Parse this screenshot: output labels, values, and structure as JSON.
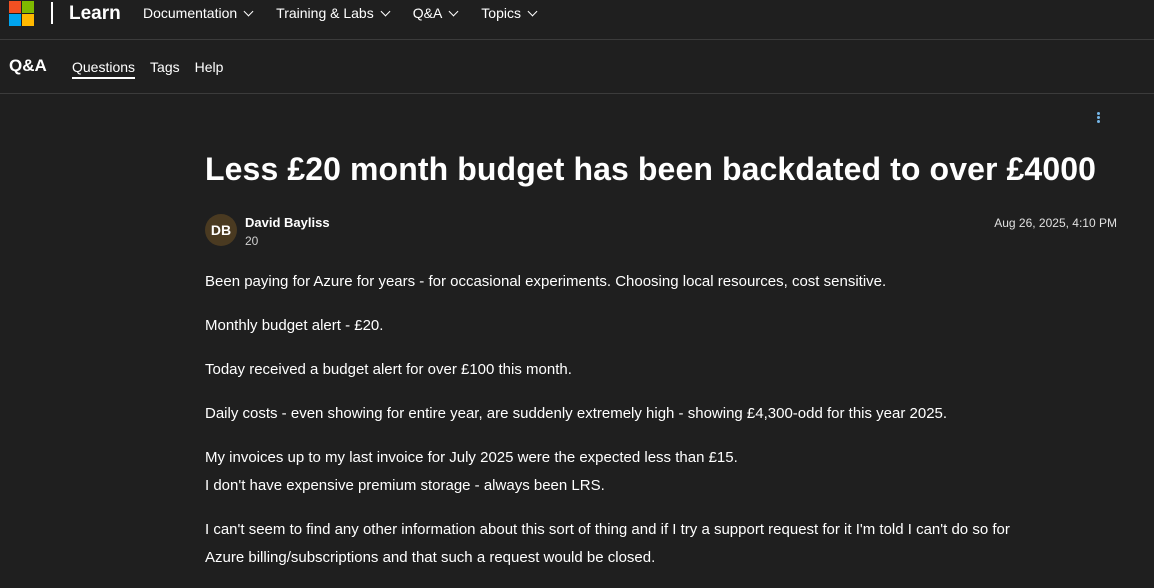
{
  "header": {
    "brand": "Learn",
    "nav": [
      {
        "label": "Documentation"
      },
      {
        "label": "Training & Labs"
      },
      {
        "label": "Q&A"
      },
      {
        "label": "Topics"
      }
    ]
  },
  "subheader": {
    "title": "Q&A",
    "nav": [
      {
        "label": "Questions",
        "active": true
      },
      {
        "label": "Tags",
        "active": false
      },
      {
        "label": "Help",
        "active": false
      }
    ]
  },
  "question": {
    "title": "Less £20 month budget has been backdated to over £4000",
    "author": {
      "initials": "DB",
      "name": "David Bayliss",
      "reputation": "20"
    },
    "date": "Aug 26, 2025, 4:10 PM",
    "paragraphs": [
      [
        "Been paying for Azure for years - for occasional experiments. Choosing local resources, cost sensitive."
      ],
      [
        "Monthly budget alert - £20."
      ],
      [
        "Today received a budget alert for over £100 this month."
      ],
      [
        "Daily costs - even showing for entire year, are suddenly extremely high - showing £4,300-odd for this year 2025."
      ],
      [
        "My invoices up to my last invoice for July 2025 were the expected less than £15.",
        "I don't have expensive premium storage - always been LRS."
      ],
      [
        "I can't seem to find any other information about this sort of thing and if I try a support request for it I'm told I can't do so for",
        "Azure billing/subscriptions and that such a request would be closed."
      ]
    ]
  },
  "colors": {
    "background": "#1f1f1f",
    "divider": "#3b3b3b",
    "avatar": "#4a3a21",
    "kebab": "#75b6e7"
  }
}
